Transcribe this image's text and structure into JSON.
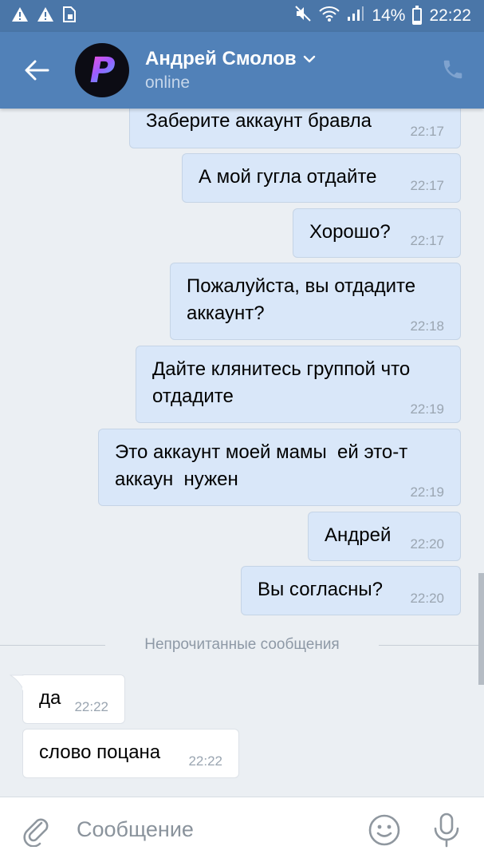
{
  "status_bar": {
    "battery": "14%",
    "battery_level": 0.14,
    "time": "22:22",
    "left_icons": [
      "warning-icon",
      "warning-icon",
      "sim-card-icon"
    ],
    "right_icons": [
      "mute-icon",
      "wifi-icon",
      "signal-icon",
      "battery-icon"
    ]
  },
  "header": {
    "contact_name": "Андрей Смолов",
    "status": "online",
    "avatar_letter": "P"
  },
  "messages": [
    {
      "direction": "out",
      "text": "Заберите аккаунт бравла",
      "time": "22:17"
    },
    {
      "direction": "out",
      "text": "А мой гугла отдайте",
      "time": "22:17"
    },
    {
      "direction": "out",
      "text": "Хорошо?",
      "time": "22:17"
    },
    {
      "direction": "out",
      "text": "Пожалуйста, вы отдадите\nаккаунт?",
      "time": "22:18"
    },
    {
      "direction": "out",
      "text": "Дайте клянитесь группой что\nотдадите",
      "time": "22:19"
    },
    {
      "direction": "out",
      "text": "Это аккаунт моей мамы  ей это-т\nаккаун  нужен",
      "time": "22:19"
    },
    {
      "direction": "out",
      "text": "Андрей",
      "time": "22:20"
    },
    {
      "direction": "out",
      "text": "Вы согласны?",
      "time": "22:20"
    },
    {
      "direction": "in",
      "text": "да",
      "time": "22:22"
    },
    {
      "direction": "in",
      "text": "слово поцана",
      "time": "22:22"
    }
  ],
  "unread_divider": "Непрочитанные сообщения",
  "composer": {
    "placeholder": "Сообщение"
  },
  "colors": {
    "header": "#5181b8",
    "status_bar": "#4a76a8",
    "chat_background": "#ebeff3",
    "outgoing_bubble": "#d9e7f9",
    "incoming_bubble": "#ffffff"
  }
}
